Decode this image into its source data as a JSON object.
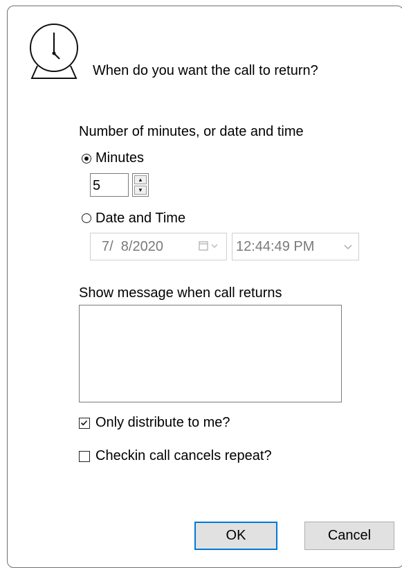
{
  "dialog": {
    "icon": "alarm-clock-icon",
    "prompt": "When do you want the call to return?",
    "group_label": "Number of minutes, or date and time",
    "minutes_option": {
      "label": "Minutes",
      "selected": true
    },
    "minutes_value": "5",
    "datetime_option": {
      "label": "Date and Time",
      "selected": false
    },
    "date_value": "7/  8/2020",
    "time_value": "12:44:49 PM",
    "message_label": "Show message when call returns",
    "message_value": "",
    "only_distribute": {
      "label": "Only distribute to me?",
      "checked": true
    },
    "checkin_cancels": {
      "label": "Checkin call cancels repeat?",
      "checked": false
    },
    "ok_label": "OK",
    "cancel_label": "Cancel"
  },
  "colors": {
    "accent": "#0078d7",
    "disabled_text": "#7a7a7a",
    "button_bg": "#e1e1e1"
  }
}
